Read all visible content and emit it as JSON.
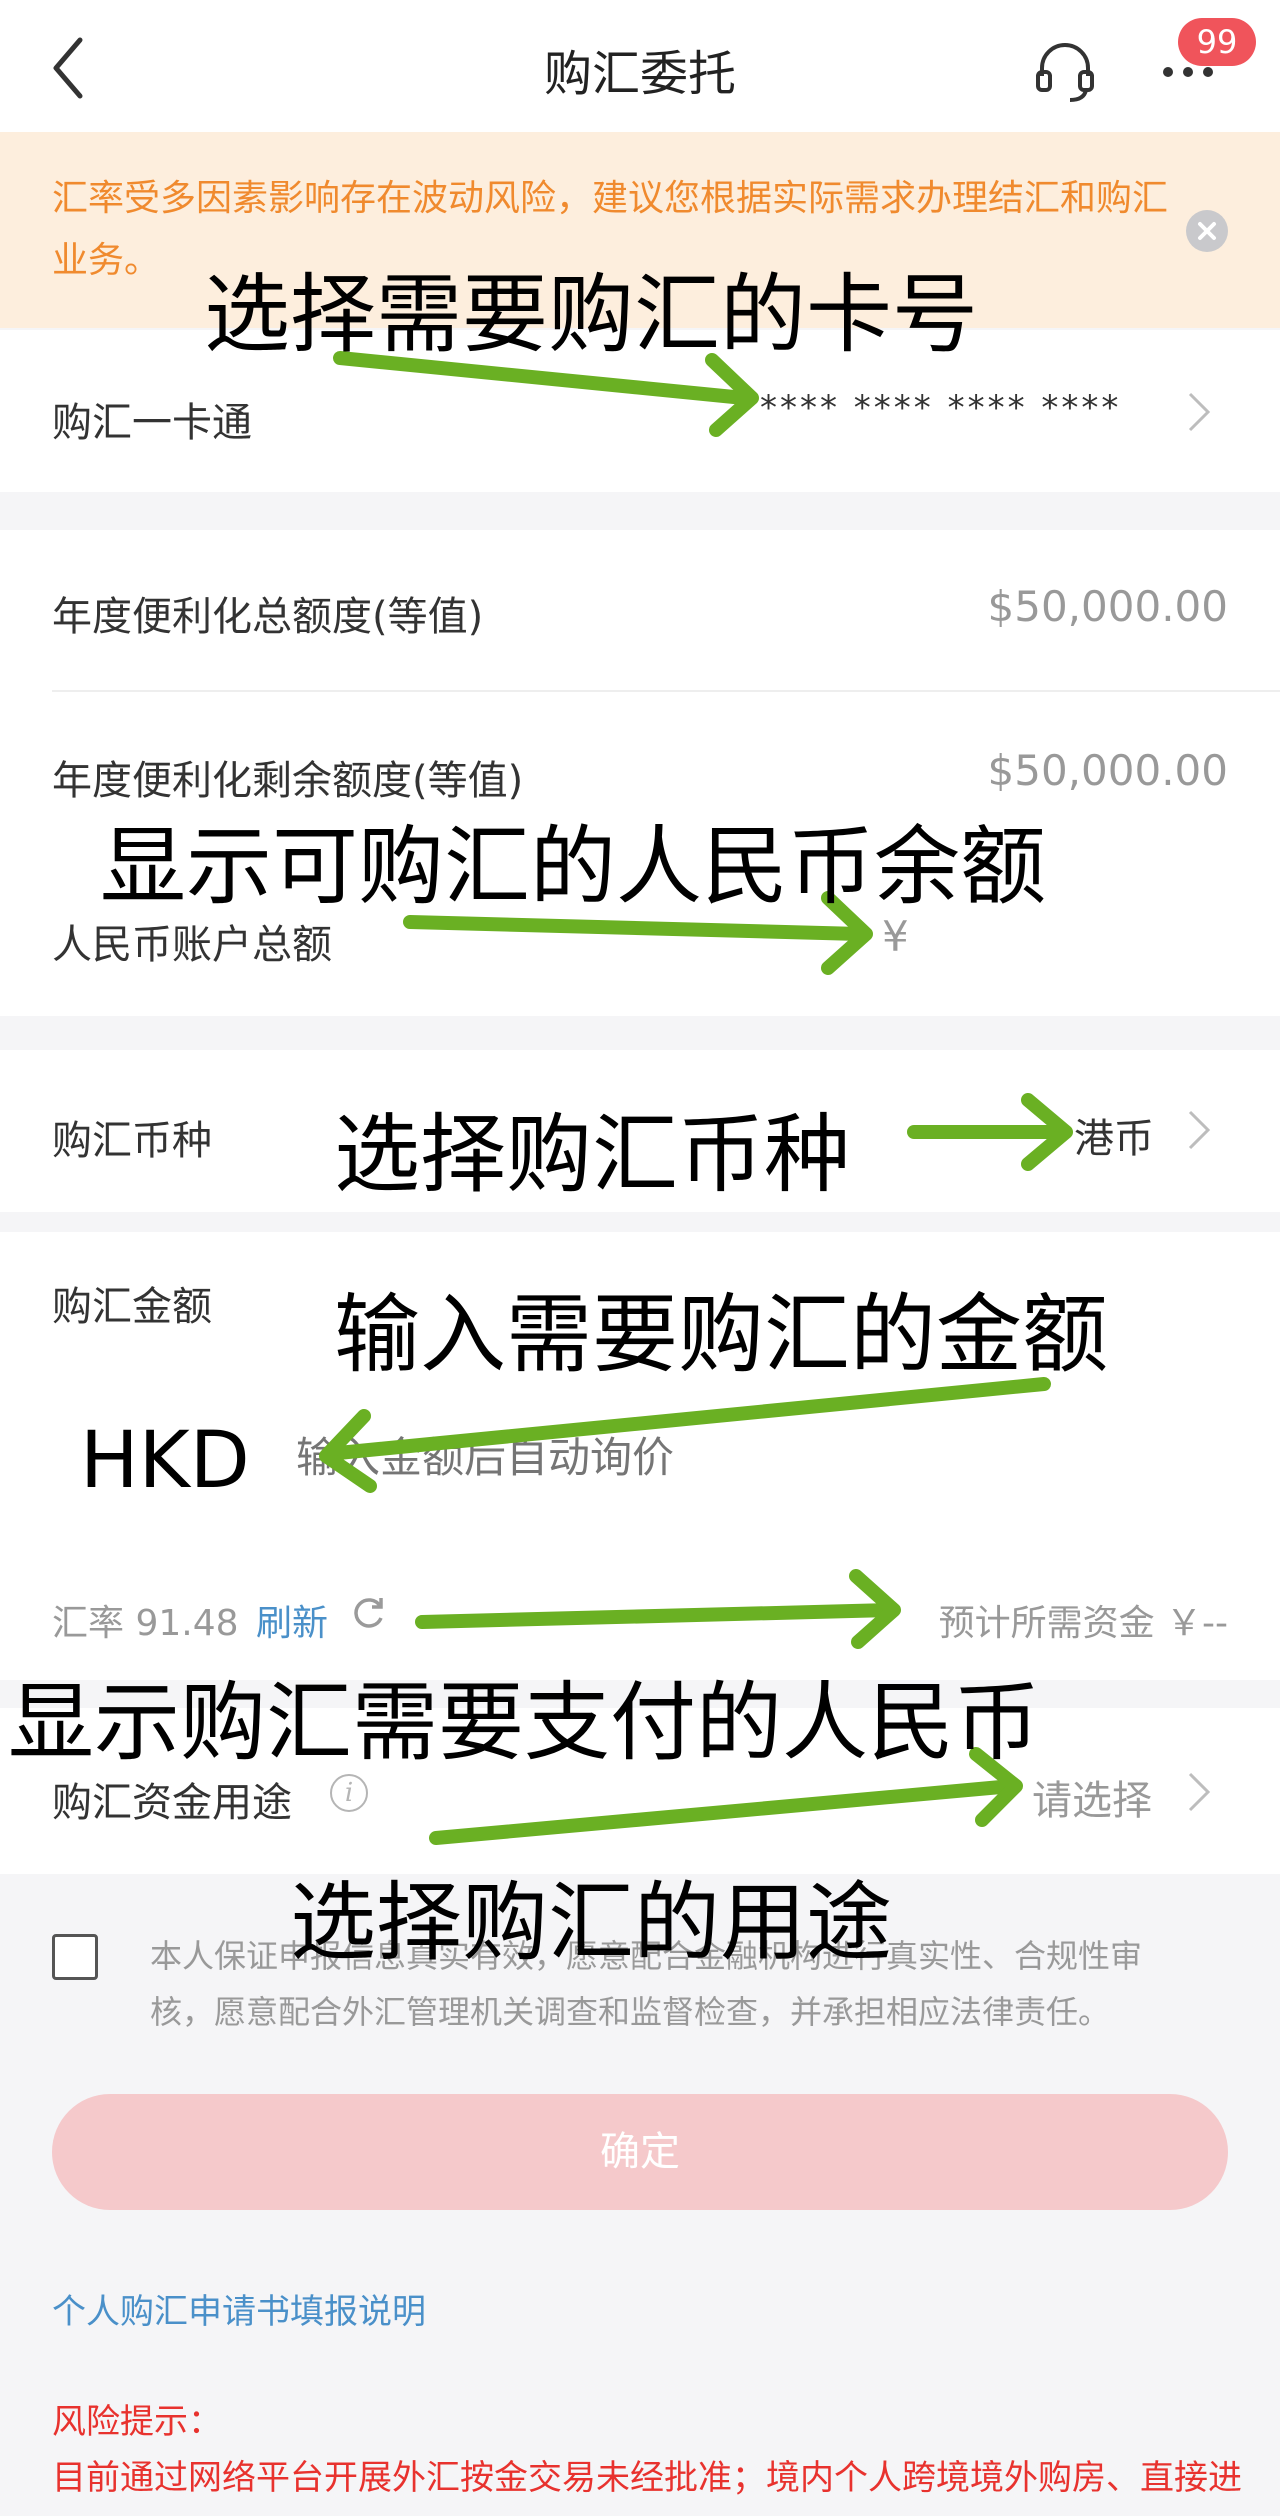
{
  "nav": {
    "title": "购汇委托",
    "badge": "99",
    "more": "···"
  },
  "banner": {
    "text": "汇率受多因素影响存在波动风险，建议您根据实际需求办理结汇和购汇业务。"
  },
  "card": {
    "label": "购汇一卡通",
    "number": "**** **** **** ****"
  },
  "quota": {
    "total_label": "年度便利化总额度(等值)",
    "total_value": "$50,000.00",
    "remaining_label": "年度便利化剩余额度(等值)",
    "remaining_value": "$50,000.00",
    "rmb_label": "人民币账户总额",
    "rmb_value": "¥"
  },
  "currency": {
    "label": "购汇币种",
    "value": "港币"
  },
  "amount": {
    "label": "购汇金额",
    "code": "HKD",
    "placeholder": "输入金额后自动询价"
  },
  "rate": {
    "label": "汇率 91.48",
    "refresh": "刷新",
    "estimate": "预计所需资金 ￥--"
  },
  "purpose": {
    "label": "购汇资金用途",
    "tip": "i",
    "value": "请选择"
  },
  "declaration": "本人保证申报信息真实有效，愿意配合金融机构进行真实性、合规性审核，愿意配合外汇管理机关调查和监督检查，并承担相应法律责任。",
  "confirm_label": "确定",
  "guide_link": "个人购汇申请书填报说明",
  "risk": {
    "title": "风险提示：",
    "text": "目前通过网络平台开展外汇按金交易未经批准；境内个人跨境境外购房、直接进"
  },
  "annotations": {
    "select_card": "选择需要购汇的卡号",
    "show_balance": "显示可购汇的人民币余额",
    "select_currency": "选择购汇币种",
    "enter_amount": "输入需要购汇的金额",
    "show_payment": "显示购汇需要支付的人民币",
    "select_purpose": "选择购汇的用途"
  },
  "colors": {
    "accent_link": "#4a90c9",
    "warning_text": "#f08a2e",
    "warning_bg": "#fdeedd",
    "badge": "#f0545b",
    "confirm_disabled": "#f5c9cb",
    "risk": "#e8322e",
    "annotation_arrow": "#6ab023"
  }
}
